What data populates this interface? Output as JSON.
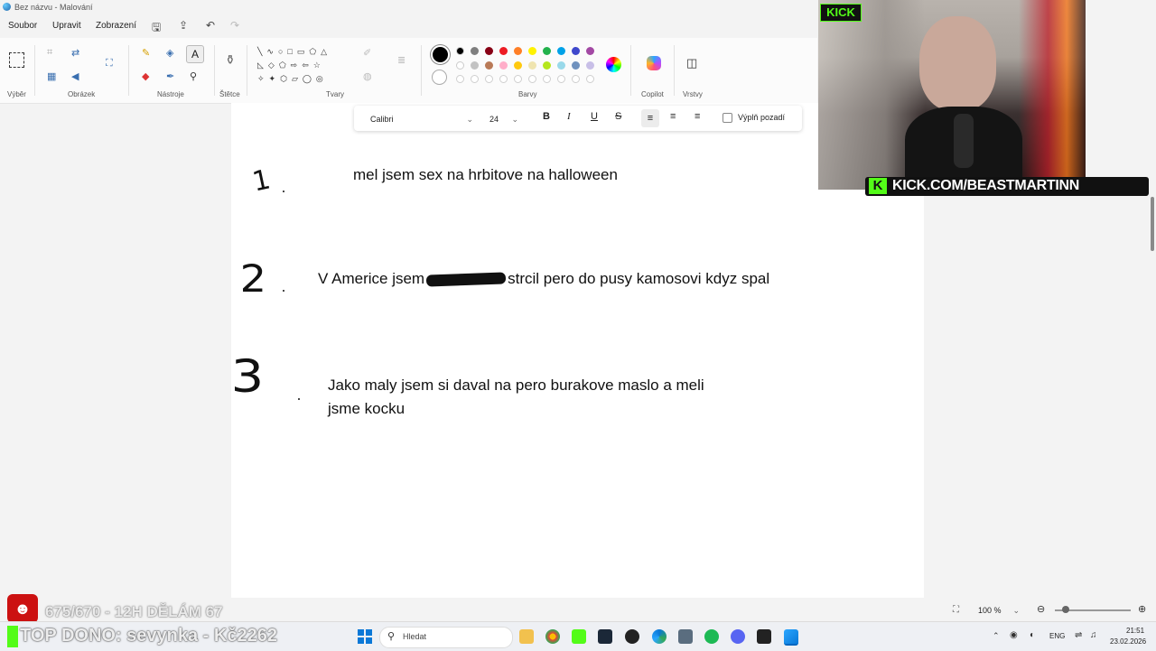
{
  "window": {
    "title": "Bez názvu - Malování"
  },
  "menu": {
    "items": [
      "Soubor",
      "Upravit",
      "Zobrazení"
    ]
  },
  "ribbon": {
    "groups": {
      "selection": "Výběr",
      "image": "Obrázek",
      "tools": "Nástroje",
      "brushes": "Štětce",
      "shapes": "Tvary",
      "colors": "Barvy",
      "copilot": "Copilot",
      "layers": "Vrstvy"
    },
    "palette_row1": [
      "#000000",
      "#7f7f7f",
      "#880015",
      "#ed1c24",
      "#ff7f27",
      "#fff200",
      "#22b14c",
      "#00a2e8",
      "#3f48cc",
      "#a349a4"
    ],
    "palette_row2": [
      "#ffffff",
      "#c3c3c3",
      "#b97a57",
      "#ffaec9",
      "#ffc90e",
      "#efe4b0",
      "#b5e61d",
      "#99d9ea",
      "#7092be",
      "#c8bfe7"
    ]
  },
  "text_toolbar": {
    "font": "Calibri",
    "size": "24",
    "bold": "B",
    "italic": "I",
    "underline": "U",
    "strike": "S",
    "fill_background": "Výplň pozadí"
  },
  "canvas": {
    "items": [
      {
        "number": "1",
        "text": "mel jsem sex na hrbitove na halloween"
      },
      {
        "number": "2",
        "text_before": "V Americe jsem",
        "text_after": "strcil pero do pusy kamosovi kdyz spal"
      },
      {
        "number": "3",
        "line1": "Jako maly jsem si daval na pero burakove maslo a meli",
        "line2": "jsme kocku"
      }
    ]
  },
  "webcam": {
    "badge": "KICK",
    "url": "KICK.COM/BEASTMARTINN"
  },
  "statusbar": {
    "zoom": "100 %"
  },
  "overlay": {
    "counter": "675/670 - 12H DĚLÁM 67",
    "dono": "TOP DONO: sevynka - Kč2262"
  },
  "taskbar": {
    "search_placeholder": "Hledat",
    "language": "ENG",
    "time": "21:51",
    "date": "23.02.2026"
  },
  "colors": {
    "accent": "#0067c0",
    "kick_green": "#53fc18"
  }
}
